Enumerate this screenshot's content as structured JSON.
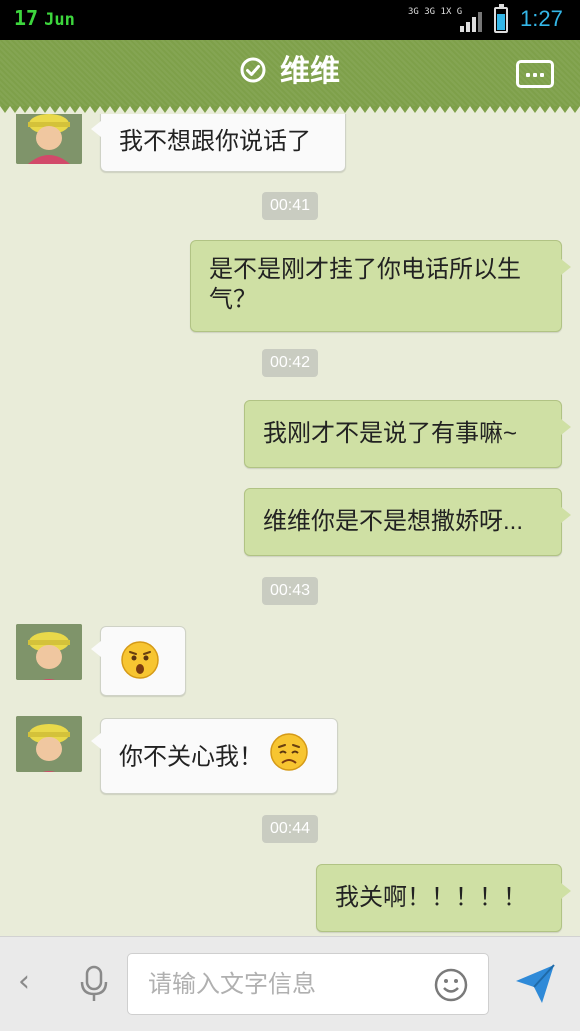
{
  "status_bar": {
    "day": "17",
    "month": "Jun",
    "network_labels": [
      "3G",
      "3G 1X",
      "G"
    ],
    "time": "1:27",
    "battery_level": 0.75
  },
  "header": {
    "title": "维维",
    "status_icon": "check-circle-icon",
    "menu_icon": "more-dots-icon",
    "color": "#7ea04a"
  },
  "messages": [
    {
      "side": "left",
      "text": "我不想跟你说话了"
    },
    {
      "type": "time",
      "text": "00:41"
    },
    {
      "side": "right",
      "text": "是不是刚才挂了你电话所以生气？"
    },
    {
      "type": "time",
      "text": "00:42"
    },
    {
      "side": "right",
      "text": "我刚才不是说了有事嘛~"
    },
    {
      "side": "right",
      "text": "维维你是不是想撒娇呀..."
    },
    {
      "type": "time",
      "text": "00:43"
    },
    {
      "side": "left",
      "emoji": "surprised-face-icon"
    },
    {
      "side": "left",
      "text": "你不关心我！",
      "emoji": "sad-face-icon"
    },
    {
      "type": "time",
      "text": "00:44"
    },
    {
      "side": "right",
      "text": "我关啊！！！！！"
    }
  ],
  "input_bar": {
    "placeholder": "请输入文字信息",
    "value": "",
    "icons": [
      "chevron-left-icon",
      "microphone-icon",
      "smiley-icon",
      "send-icon"
    ]
  },
  "colors": {
    "right_bubble": "#cfe0a4",
    "left_bubble": "#fafafa",
    "accent": "#2f8ad8"
  }
}
